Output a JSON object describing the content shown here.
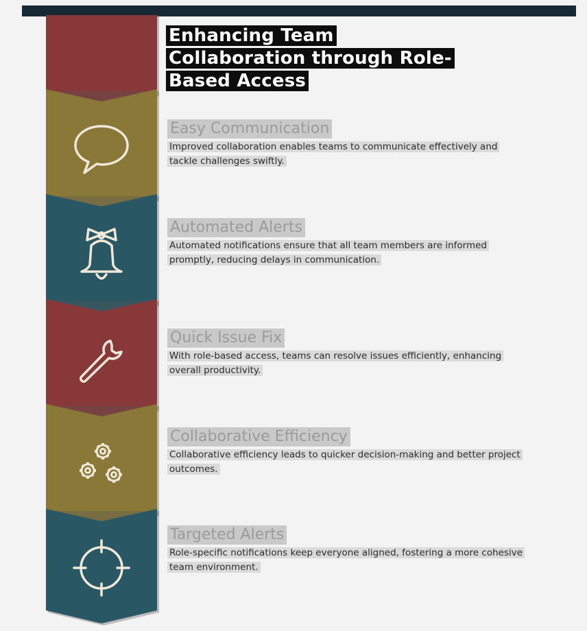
{
  "title": "Enhancing Team Collaboration through Role-Based Access",
  "colors": {
    "red": "#883838",
    "gold": "#8a7838",
    "teal": "#2a5764",
    "dark": "#172935",
    "icon": "#efe7d8"
  },
  "items": [
    {
      "title": "Easy Communication",
      "description": "Improved collaboration enables teams to communicate effectively and tackle challenges swiftly.",
      "icon": "speech-bubble-icon"
    },
    {
      "title": "Automated Alerts",
      "description": "Automated notifications ensure that all team members are informed promptly, reducing delays in communication.",
      "icon": "bell-icon"
    },
    {
      "title": "Quick Issue Fix",
      "description": "With role-based access, teams can resolve issues efficiently, enhancing overall productivity.",
      "icon": "wrench-icon"
    },
    {
      "title": "Collaborative Efficiency",
      "description": "Collaborative efficiency leads to quicker decision-making and better project outcomes.",
      "icon": "gears-icon"
    },
    {
      "title": "Targeted Alerts",
      "description": "Role-specific notifications keep everyone aligned, fostering a more cohesive team environment.",
      "icon": "crosshair-icon"
    }
  ]
}
